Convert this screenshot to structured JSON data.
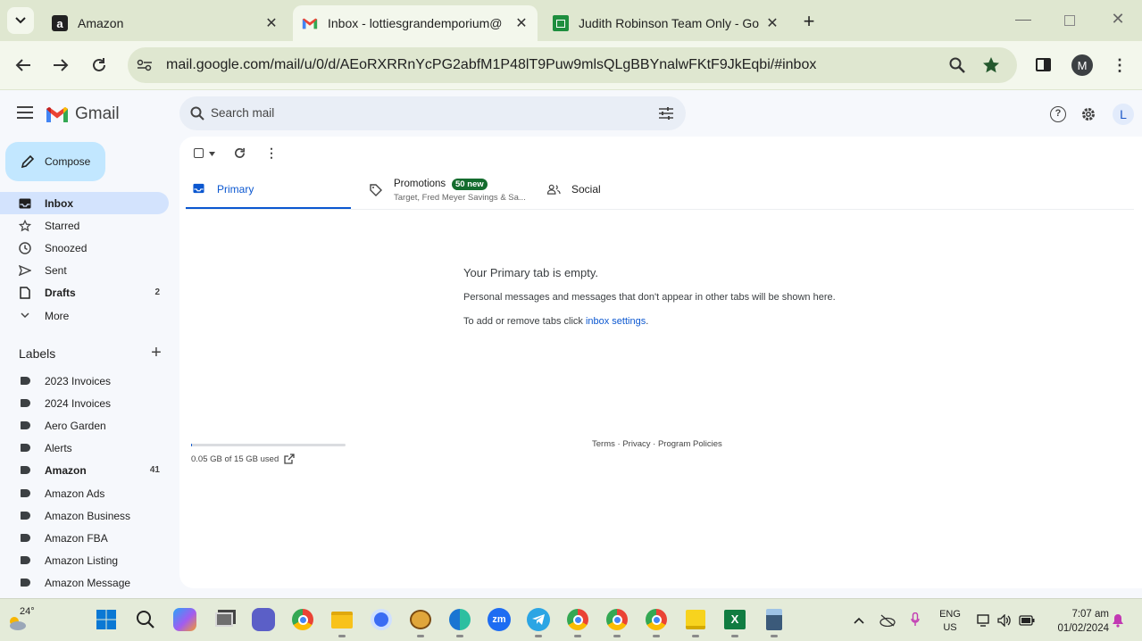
{
  "browser": {
    "tabs": [
      {
        "title": "Amazon",
        "active": false
      },
      {
        "title": "Inbox - lottiesgrandemporium@",
        "active": true
      },
      {
        "title": "Judith Robinson Team Only - Go",
        "active": false
      }
    ],
    "url": "mail.google.com/mail/u/0/d/AEoRXRRnYcPG2abfM1P48lT9Puw9mlsQLgBBYnalwFKtF9JkEqbi/#inbox",
    "profile_initial": "M"
  },
  "gmail": {
    "logo_text": "Gmail",
    "search_placeholder": "Search mail",
    "account_initial": "L",
    "compose_label": "Compose",
    "nav": [
      {
        "label": "Inbox",
        "count": "",
        "icon": "inbox-icon"
      },
      {
        "label": "Starred",
        "count": "",
        "icon": "star-icon"
      },
      {
        "label": "Snoozed",
        "count": "",
        "icon": "clock-icon"
      },
      {
        "label": "Sent",
        "count": "",
        "icon": "send-icon"
      },
      {
        "label": "Drafts",
        "count": "2",
        "icon": "draft-icon"
      },
      {
        "label": "More",
        "count": "",
        "icon": "chevron-down-icon"
      }
    ],
    "labels_heading": "Labels",
    "labels": [
      {
        "label": "2023 Invoices",
        "count": ""
      },
      {
        "label": "2024 Invoices",
        "count": ""
      },
      {
        "label": "Aero Garden",
        "count": ""
      },
      {
        "label": "Alerts",
        "count": ""
      },
      {
        "label": "Amazon",
        "count": "41"
      },
      {
        "label": "Amazon Ads",
        "count": ""
      },
      {
        "label": "Amazon Business",
        "count": ""
      },
      {
        "label": "Amazon FBA",
        "count": ""
      },
      {
        "label": "Amazon Listing",
        "count": ""
      },
      {
        "label": "Amazon Message",
        "count": ""
      }
    ],
    "inbox_tabs": {
      "primary": "Primary",
      "promotions": "Promotions",
      "promotions_badge": "50 new",
      "promotions_sub": "Target, Fred Meyer Savings & Sa...",
      "social": "Social"
    },
    "empty": {
      "title": "Your Primary tab is empty.",
      "line1": "Personal messages and messages that don't appear in other tabs will be shown here.",
      "line2_prefix": "To add or remove tabs click ",
      "line2_link": "inbox settings",
      "line2_suffix": "."
    },
    "storage": {
      "text": "0.05 GB of 15 GB used",
      "fraction": 0.0033
    },
    "footer": {
      "terms": "Terms",
      "sep1": " · ",
      "privacy": "Privacy",
      "sep2": " · ",
      "policies": "Program Policies"
    },
    "accent": "#0b57d0"
  },
  "taskbar": {
    "weather": "24°",
    "lang_top": "ENG",
    "lang_bottom": "US",
    "time": "7:07 am",
    "date": "01/02/2024"
  }
}
